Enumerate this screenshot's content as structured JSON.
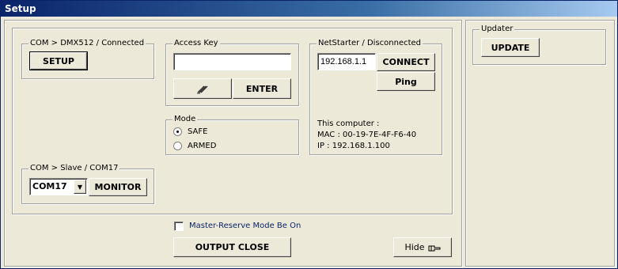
{
  "window": {
    "title": "Setup"
  },
  "dmx": {
    "legend": "COM > DMX512 / Connected",
    "setup_label": "SETUP"
  },
  "access_key": {
    "legend": "Access Key",
    "value": "",
    "enter_label": "ENTER",
    "key_icon": "key-icon"
  },
  "netstarter": {
    "legend": "NetStarter / Disconnected",
    "ip_value": "192.168.1.1",
    "connect_label": "CONNECT",
    "ping_label": "Ping",
    "info_title": "This computer :",
    "mac_line": "MAC : 00-19-7E-4F-F6-40",
    "ip_line": "IP : 192.168.1.100"
  },
  "mode": {
    "legend": "Mode",
    "options": [
      "SAFE",
      "ARMED"
    ],
    "selected": "SAFE"
  },
  "slave": {
    "legend": "COM > Slave / COM17",
    "port_value": "COM17",
    "monitor_label": "MONITOR"
  },
  "master_reserve": {
    "label": "Master-Reserve Mode Be On",
    "checked": false
  },
  "output_close_label": "OUTPUT CLOSE",
  "hide_label": "Hide",
  "updater": {
    "legend": "Updater",
    "update_label": "UPDATE"
  }
}
